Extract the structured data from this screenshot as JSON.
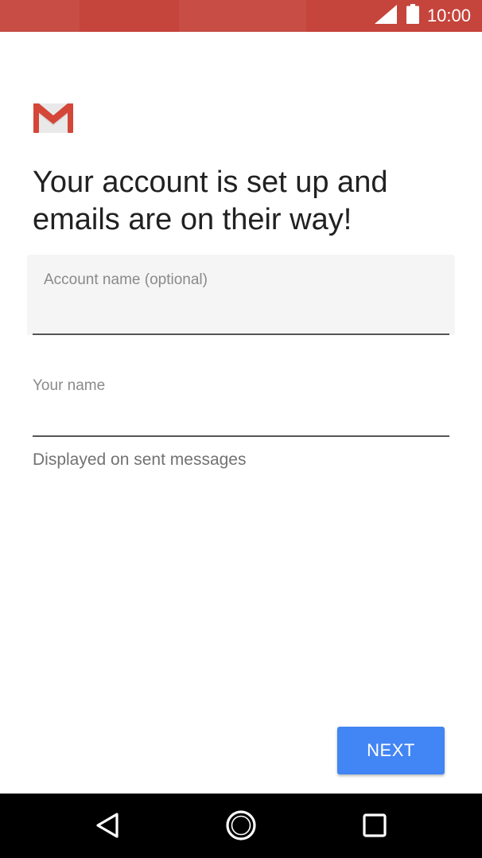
{
  "status_bar": {
    "time": "10:00",
    "background_color": "#c5443b",
    "icons": [
      "cell-signal-icon",
      "battery-icon"
    ]
  },
  "app": {
    "logo_icon": "gmail-logo-icon"
  },
  "main": {
    "headline": "Your account is set up and emails are on their way!",
    "account_name_field": {
      "label": "Account name (optional)",
      "value": ""
    },
    "your_name_field": {
      "label": "Your name",
      "value": ""
    },
    "helper_text": "Displayed on sent messages"
  },
  "actions": {
    "next_label": "NEXT",
    "accent_color": "#4285f4"
  },
  "nav_bar": {
    "icons": [
      "back-icon",
      "home-icon",
      "recents-icon"
    ]
  }
}
